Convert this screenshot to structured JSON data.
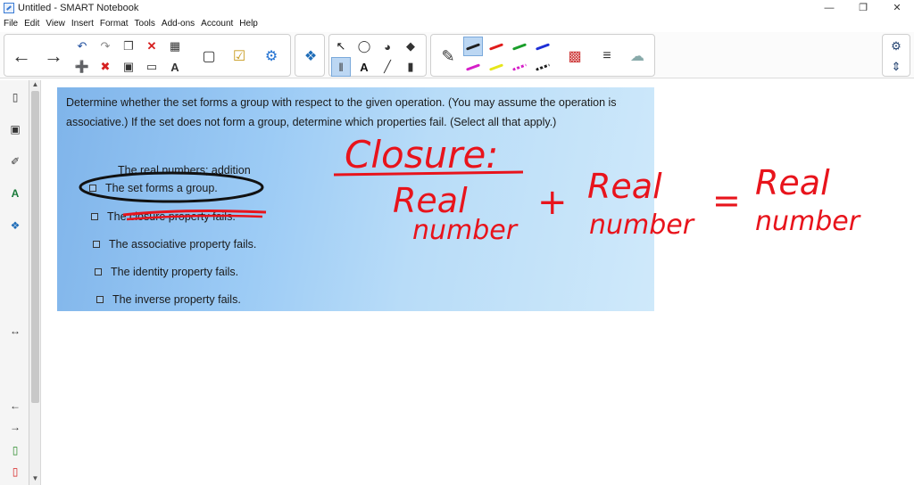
{
  "window": {
    "title": "Untitled - SMART Notebook",
    "controls": [
      "—",
      "❐",
      "✕"
    ]
  },
  "menu": [
    "File",
    "Edit",
    "View",
    "Insert",
    "Format",
    "Tools",
    "Add-ons",
    "Account",
    "Help"
  ],
  "question": {
    "prompt": "Determine whether the set forms a group with respect to the given operation. (You may assume the operation is associative.) If the set does not form a group, determine which properties fail. (Select all that apply.)",
    "subtitle": "The real numbers; addition",
    "options": [
      "The set forms a group.",
      "The closure property fails.",
      "The associative property fails.",
      "The identity property fails.",
      "The inverse property fails."
    ]
  },
  "handwriting": {
    "heading": "Closure:",
    "left_term": [
      "Real",
      "number"
    ],
    "plus": "+",
    "right_term": [
      "Real",
      "number"
    ],
    "equals": "=",
    "result": [
      "Real",
      "number"
    ],
    "ink_color": "#e8141c"
  },
  "pen_colors": [
    "#1f1f1f",
    "#e01b1b",
    "#1a9e2a",
    "#1e2fd6",
    "#d61fc8",
    "#e6e61a",
    "#d61fc8",
    "#1f1f1f"
  ],
  "icons": [
    "back-icon",
    "forward-icon",
    "undo-icon",
    "redo-icon",
    "paste-icon",
    "delete-icon",
    "table-icon",
    "screen-shade-icon",
    "add-on-icon",
    "select-icon",
    "shapes-icon",
    "fill-icon",
    "text-icon",
    "line-icon",
    "eraser-icon",
    "pen-icon",
    "color-palette-icon",
    "settings-icon"
  ]
}
